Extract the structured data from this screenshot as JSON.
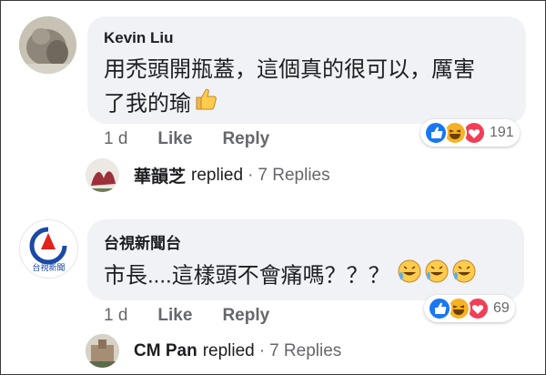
{
  "comments": [
    {
      "author": "Kevin Liu",
      "text_line1": "用禿頭開瓶蓋，這個真的很可以，厲害",
      "text_line2": "了我的瑜",
      "text_emoji": "thumbs-up",
      "time": "1 d",
      "like_label": "Like",
      "reply_label": "Reply",
      "reaction_count": "191",
      "reactions": [
        "like-reaction",
        "haha-reaction",
        "love-reaction"
      ],
      "reply_preview": {
        "name": "華韻芝",
        "verb": "replied",
        "separator": "·",
        "count": "7 Replies"
      }
    },
    {
      "author": "台視新聞台",
      "avatar_caption": "台視新聞",
      "text_line1": "市長....這樣頭不會痛嗎？？？",
      "text_emoji": "rofl-x3",
      "time": "1 d",
      "like_label": "Like",
      "reply_label": "Reply",
      "reaction_count": "69",
      "reactions": [
        "like-reaction",
        "haha-reaction",
        "love-reaction"
      ],
      "reply_preview": {
        "name": "CM Pan",
        "verb": "replied",
        "separator": "·",
        "count": "7 Replies"
      }
    }
  ],
  "colors": {
    "bubble": "#f0f2f5",
    "meta": "#65676b",
    "like_blue": "#1877f2",
    "love_red": "#f33e58",
    "haha_yellow": "#f7b125"
  }
}
